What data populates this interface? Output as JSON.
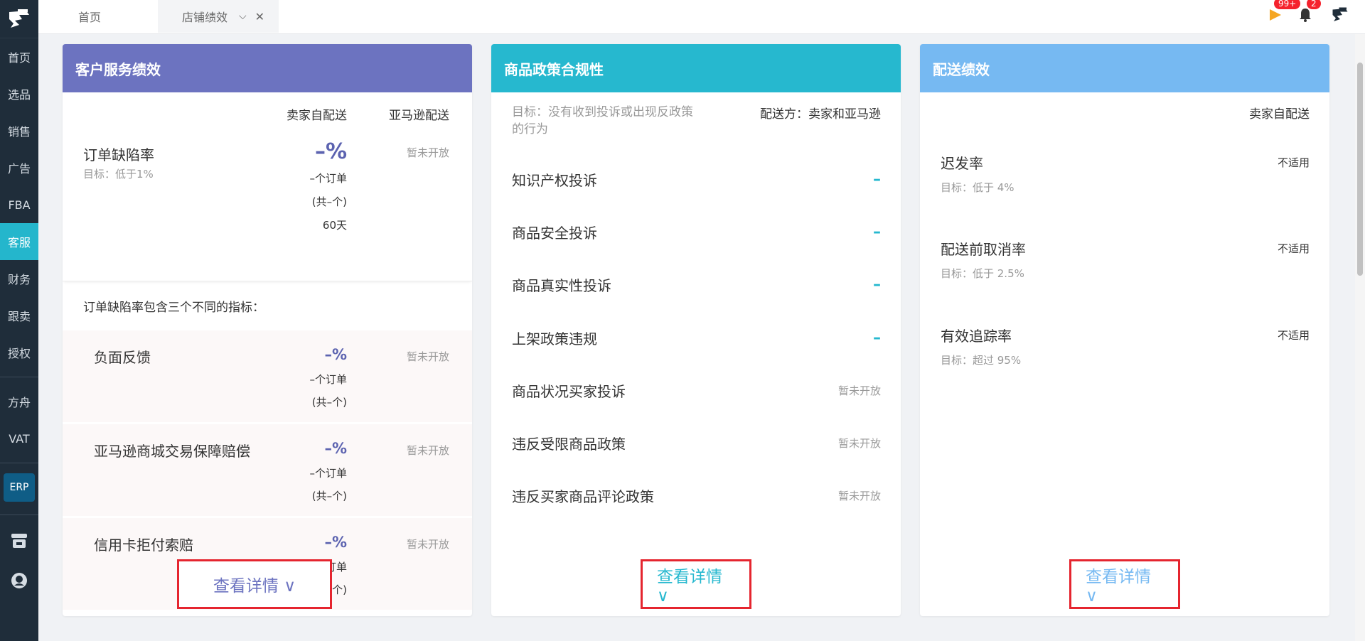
{
  "sidebar": {
    "items": [
      {
        "label": "首页",
        "active": false
      },
      {
        "label": "选品",
        "active": false
      },
      {
        "label": "销售",
        "active": false
      },
      {
        "label": "广告",
        "active": false
      },
      {
        "label": "FBA",
        "active": false
      },
      {
        "label": "客服",
        "active": true
      },
      {
        "label": "财务",
        "active": false
      },
      {
        "label": "跟卖",
        "active": false
      },
      {
        "label": "授权",
        "active": false
      }
    ],
    "items2": [
      {
        "label": "方舟"
      },
      {
        "label": "VAT"
      }
    ],
    "erp_label": "ERP",
    "bottom_icons": [
      "store-icon",
      "support-icon"
    ]
  },
  "topbar": {
    "tabs": [
      {
        "label": "首页"
      },
      {
        "label": "店铺绩效"
      }
    ],
    "flag_badge": "99+",
    "bell_badge": "2"
  },
  "colors": {
    "card1": "#6c73c0",
    "card2": "#26b8cf",
    "card3": "#76b9f2",
    "active_nav": "#24b6cc",
    "highlight_border": "#e5252f"
  },
  "card1": {
    "title": "客户服务绩效",
    "col_seller": "卖家自配送",
    "col_amazon": "亚马逊配送",
    "main_metric": {
      "title": "订单缺陷率",
      "goal": "目标：低于1%",
      "pct": "–%",
      "orders": "–个订单",
      "total": "(共–个)",
      "days": "60天",
      "amazon": "暂未开放"
    },
    "desc": "订单缺陷率包含三个不同的指标：",
    "sub_metrics": [
      {
        "title": "负面反馈",
        "pct": "–%",
        "orders": "–个订单",
        "total": "(共–个)",
        "amazon": "暂未开放"
      },
      {
        "title": "亚马逊商城交易保障赔偿",
        "pct": "–%",
        "orders": "–个订单",
        "total": "(共–个)",
        "amazon": "暂未开放"
      },
      {
        "title": "信用卡拒付索赔",
        "pct": "–%",
        "orders": "–个订单",
        "total": "(共–个)",
        "amazon": "暂未开放"
      }
    ],
    "view_label": "查看详情 ∨"
  },
  "card2": {
    "title": "商品政策合规性",
    "goal": "目标：没有收到投诉或出现反政策的行为",
    "shipping": "配送方：卖家和亚马逊",
    "rows": [
      {
        "label": "知识产权投诉",
        "value": "–"
      },
      {
        "label": "商品安全投诉",
        "value": "–"
      },
      {
        "label": "商品真实性投诉",
        "value": "–"
      },
      {
        "label": "上架政策违规",
        "value": "–"
      },
      {
        "label": "商品状况买家投诉",
        "value": "暂未开放"
      },
      {
        "label": "违反受限商品政策",
        "value": "暂未开放"
      },
      {
        "label": "违反买家商品评论政策",
        "value": "暂未开放"
      }
    ],
    "view_label": "查看详情 ∨"
  },
  "card3": {
    "title": "配送绩效",
    "col_seller": "卖家自配送",
    "metrics": [
      {
        "title": "迟发率",
        "goal": "目标：低于 4%",
        "value": "不适用"
      },
      {
        "title": "配送前取消率",
        "goal": "目标：低于 2.5%",
        "value": "不适用"
      },
      {
        "title": "有效追踪率",
        "goal": "目标：超过 95%",
        "value": "不适用"
      }
    ],
    "view_label": "查看详情 ∨"
  }
}
